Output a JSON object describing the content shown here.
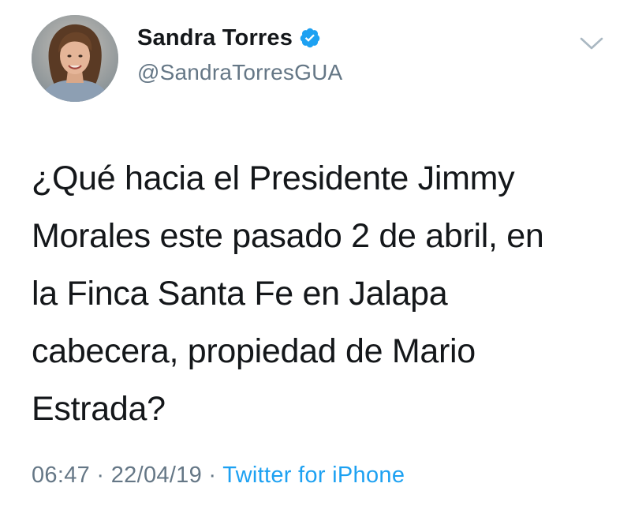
{
  "user": {
    "display_name": "Sandra Torres",
    "handle": "@SandraTorresGUA",
    "verified": true,
    "avatar_icon": "profile-photo"
  },
  "tweet": {
    "text": "¿Qué hacia el Presidente Jimmy\nMorales este pasado 2 de abril, en\nla Finca Santa Fe en Jalapa\ncabecera, propiedad de Mario\nEstrada?"
  },
  "meta": {
    "time": "06:47",
    "separator": " · ",
    "date": "22/04/19",
    "source": "Twitter for iPhone"
  },
  "icons": {
    "verified": "verified-badge-icon",
    "menu": "chevron-down-icon"
  },
  "colors": {
    "primary_text": "#14171a",
    "secondary_text": "#657786",
    "link": "#1da1f2",
    "verified": "#1da1f2"
  }
}
